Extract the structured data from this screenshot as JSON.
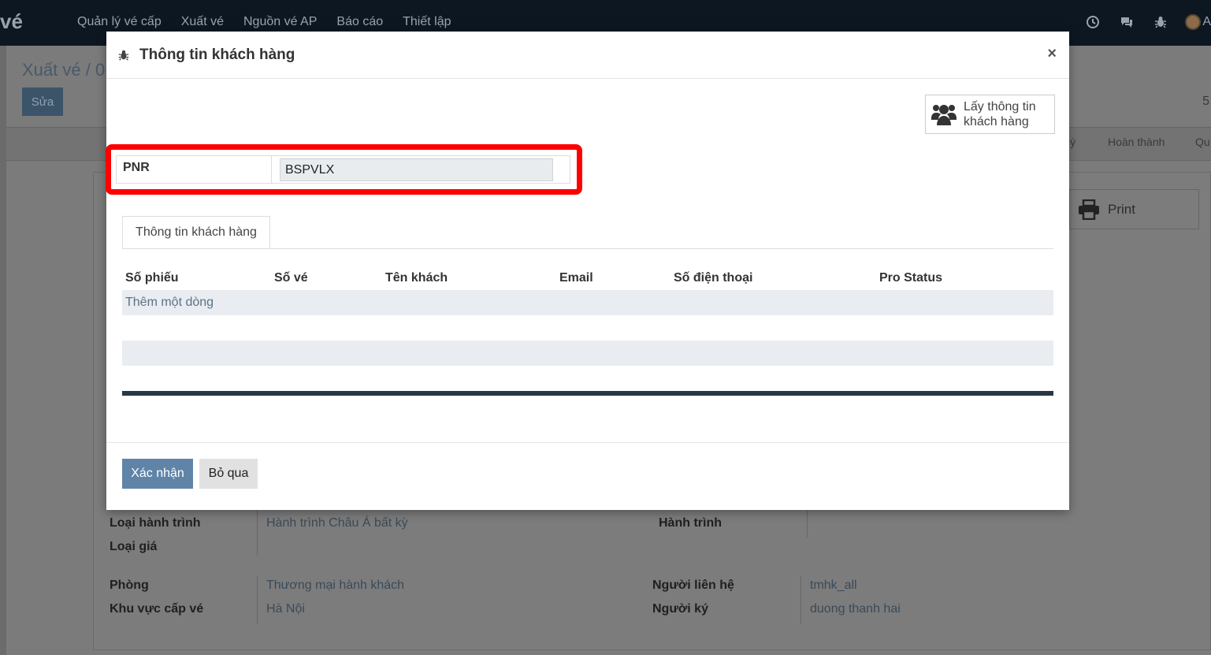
{
  "app": {
    "brand": "vé",
    "menu": [
      "Quản lý vé cấp",
      "Xuất vé",
      "Nguồn vé AP",
      "Báo cáo",
      "Thiết lập"
    ],
    "user_initial": "A"
  },
  "background": {
    "breadcrumb": "Xuất vé / 0",
    "edit_label": "Sửa",
    "pager": "5",
    "stages": [
      "lý",
      "Hoàn thành",
      "Qu"
    ],
    "print_label": "Print",
    "fields": {
      "route_type_label": "Loại hành trình",
      "route_type_value": "Hành trình Châu Á bất kỳ",
      "fare_type_label": "Loại giá",
      "itinerary_label": "Hành trình",
      "department_label": "Phòng",
      "department_value": "Thương mại hành khách",
      "contact_label": "Người liên hệ",
      "contact_value": "tmhk_all",
      "region_label": "Khu vực cấp vé",
      "region_value": "Hà Nội",
      "signer_label": "Người ký",
      "signer_value": "duong thanh hai"
    }
  },
  "modal": {
    "title": "Thông tin khách hàng",
    "close_symbol": "×",
    "fetch_button_label": "Lấy thông tin khách hàng",
    "pnr_label": "PNR",
    "pnr_value": "BSPVLX",
    "tab_label": "Thông tin khách hàng",
    "columns": [
      "Số phiếu",
      "Số vé",
      "Tên khách",
      "Email",
      "Số điện thoại",
      "Pro Status"
    ],
    "add_line_label": "Thêm một dòng",
    "confirm_label": "Xác nhận",
    "cancel_label": "Bỏ qua"
  },
  "colors": {
    "highlight": "#ff0000",
    "primary": "#5f84a8",
    "navbar": "#0d1721"
  }
}
